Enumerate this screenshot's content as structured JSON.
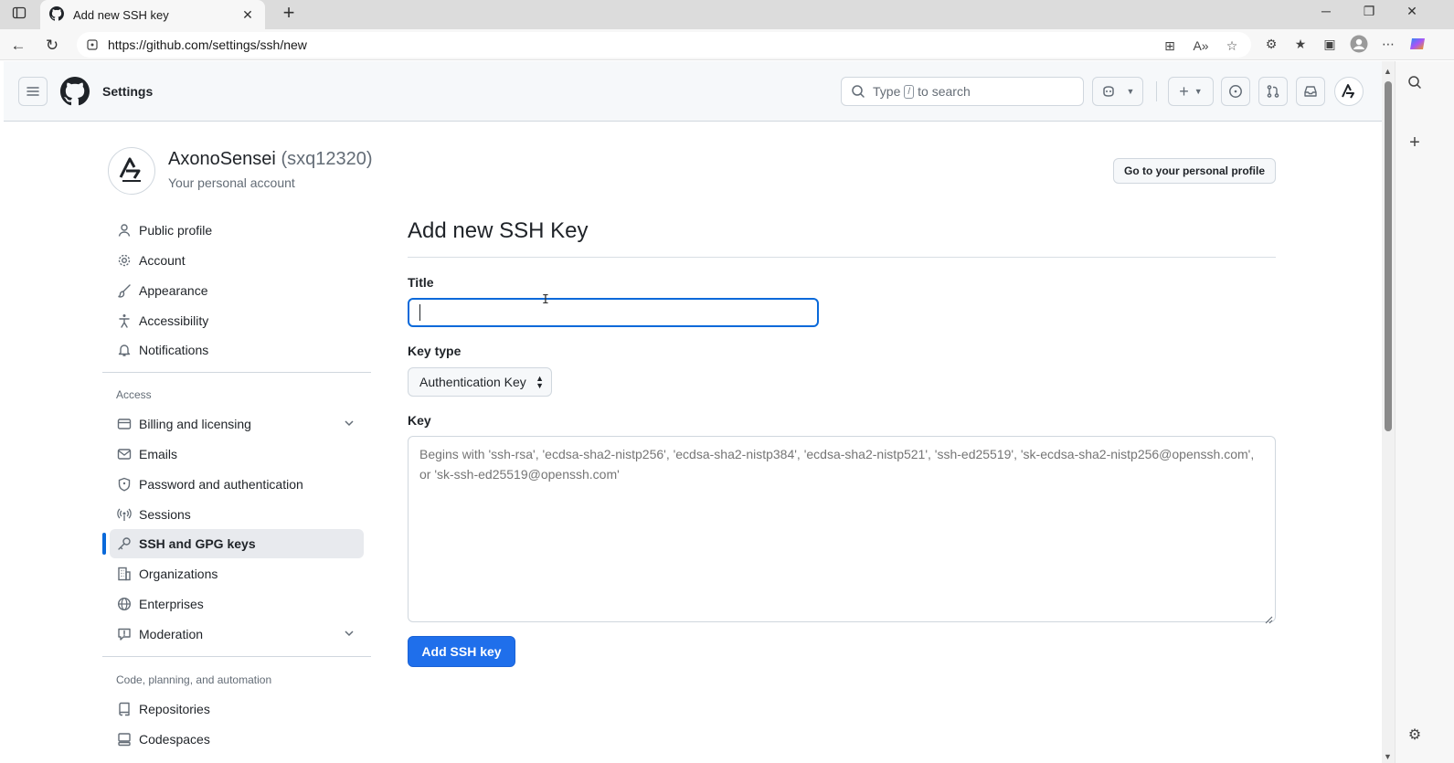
{
  "browser": {
    "tab_title": "Add new SSH key",
    "url": "https://github.com/settings/ssh/new"
  },
  "header": {
    "context": "Settings",
    "search_prefix": "Type",
    "search_key": "/",
    "search_suffix": "to search"
  },
  "account": {
    "name": "AxonoSensei",
    "login": "(sxq12320)",
    "subtitle": "Your personal account",
    "profile_button": "Go to your personal profile"
  },
  "sidebar": {
    "top_items": [
      {
        "label": "Public profile",
        "icon": "person-icon"
      },
      {
        "label": "Account",
        "icon": "gear-icon"
      },
      {
        "label": "Appearance",
        "icon": "paintbrush-icon"
      },
      {
        "label": "Accessibility",
        "icon": "accessibility-icon"
      },
      {
        "label": "Notifications",
        "icon": "bell-icon"
      }
    ],
    "access_heading": "Access",
    "access_items": [
      {
        "label": "Billing and licensing",
        "icon": "credit-card-icon"
      },
      {
        "label": "Emails",
        "icon": "mail-icon"
      },
      {
        "label": "Password and authentication",
        "icon": "shield-lock-icon"
      },
      {
        "label": "Sessions",
        "icon": "broadcast-icon"
      },
      {
        "label": "SSH and GPG keys",
        "icon": "key-icon",
        "active": true
      },
      {
        "label": "Organizations",
        "icon": "organization-icon"
      },
      {
        "label": "Enterprises",
        "icon": "globe-icon"
      },
      {
        "label": "Moderation",
        "icon": "report-icon"
      }
    ],
    "code_heading": "Code, planning, and automation",
    "code_items": [
      {
        "label": "Repositories",
        "icon": "repo-icon"
      },
      {
        "label": "Codespaces",
        "icon": "codespaces-icon"
      }
    ]
  },
  "form": {
    "heading": "Add new SSH Key",
    "title_label": "Title",
    "title_value": "",
    "key_type_label": "Key type",
    "key_type_value": "Authentication Key",
    "key_label": "Key",
    "key_placeholder": "Begins with 'ssh-rsa', 'ecdsa-sha2-nistp256', 'ecdsa-sha2-nistp384', 'ecdsa-sha2-nistp521', 'ssh-ed25519', 'sk-ecdsa-sha2-nistp256@openssh.com', or 'sk-ssh-ed25519@openssh.com'",
    "submit_label": "Add SSH key"
  },
  "colors": {
    "primary": "#1f6feb",
    "focus": "#0969da",
    "active_bar": "#0969da"
  }
}
